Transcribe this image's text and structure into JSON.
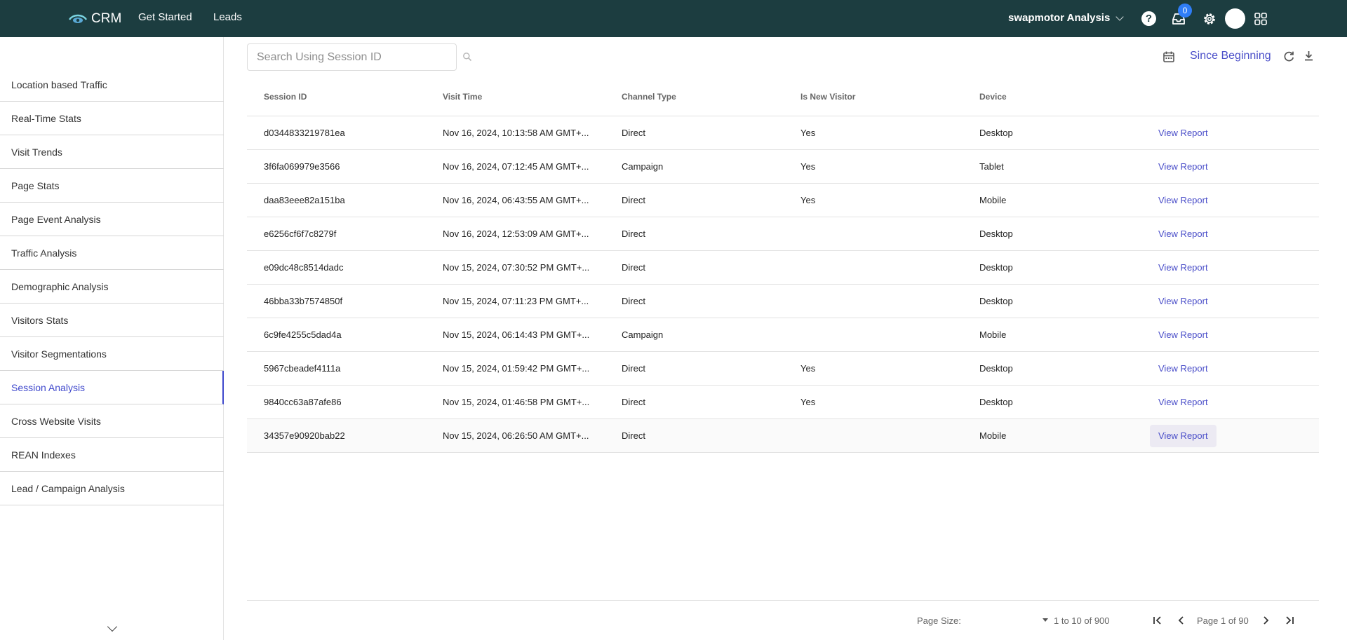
{
  "topbar": {
    "app_name": "CRM",
    "nav": [
      "Get Started",
      "Leads"
    ],
    "workspace": "swapmotor Analysis",
    "notification_count": "0",
    "background_color": "#1c3d40"
  },
  "sidebar": {
    "items": [
      {
        "label": "Location based Traffic"
      },
      {
        "label": "Real-Time Stats"
      },
      {
        "label": "Visit Trends"
      },
      {
        "label": "Page Stats"
      },
      {
        "label": "Page Event Analysis"
      },
      {
        "label": "Traffic Analysis"
      },
      {
        "label": "Demographic Analysis"
      },
      {
        "label": "Visitors Stats"
      },
      {
        "label": "Visitor Segmentations"
      },
      {
        "label": "Session Analysis"
      },
      {
        "label": "Cross Website Visits"
      },
      {
        "label": "REAN Indexes"
      },
      {
        "label": "Lead / Campaign Analysis"
      }
    ],
    "active_index": 9,
    "accent_color": "#3f48cc"
  },
  "toolbar": {
    "search_placeholder": "Search Using Session ID",
    "date_range": "Since Beginning"
  },
  "table": {
    "headers": [
      "Session ID",
      "Visit Time",
      "Channel Type",
      "Is New Visitor",
      "Device"
    ],
    "action_label": "View Report",
    "rows": [
      {
        "session_id": "d0344833219781ea",
        "visit_time": "Nov 16, 2024, 10:13:58 AM GMT+...",
        "channel": "Direct",
        "new_visitor": "Yes",
        "device": "Desktop"
      },
      {
        "session_id": "3f6fa069979e3566",
        "visit_time": "Nov 16, 2024, 07:12:45 AM GMT+...",
        "channel": "Campaign",
        "new_visitor": "Yes",
        "device": "Tablet"
      },
      {
        "session_id": "daa83eee82a151ba",
        "visit_time": "Nov 16, 2024, 06:43:55 AM GMT+...",
        "channel": "Direct",
        "new_visitor": "Yes",
        "device": "Mobile"
      },
      {
        "session_id": "e6256cf6f7c8279f",
        "visit_time": "Nov 16, 2024, 12:53:09 AM GMT+...",
        "channel": "Direct",
        "new_visitor": "",
        "device": "Desktop"
      },
      {
        "session_id": "e09dc48c8514dadc",
        "visit_time": "Nov 15, 2024, 07:30:52 PM GMT+...",
        "channel": "Direct",
        "new_visitor": "",
        "device": "Desktop"
      },
      {
        "session_id": "46bba33b7574850f",
        "visit_time": "Nov 15, 2024, 07:11:23 PM GMT+...",
        "channel": "Direct",
        "new_visitor": "",
        "device": "Desktop"
      },
      {
        "session_id": "6c9fe4255c5dad4a",
        "visit_time": "Nov 15, 2024, 06:14:43 PM GMT+...",
        "channel": "Campaign",
        "new_visitor": "",
        "device": "Mobile"
      },
      {
        "session_id": "5967cbeadef4111a",
        "visit_time": "Nov 15, 2024, 01:59:42 PM GMT+...",
        "channel": "Direct",
        "new_visitor": "Yes",
        "device": "Desktop"
      },
      {
        "session_id": "9840cc63a87afe86",
        "visit_time": "Nov 15, 2024, 01:46:58 PM GMT+...",
        "channel": "Direct",
        "new_visitor": "Yes",
        "device": "Desktop"
      },
      {
        "session_id": "34357e90920bab22",
        "visit_time": "Nov 15, 2024, 06:26:50 AM GMT+...",
        "channel": "Direct",
        "new_visitor": "",
        "device": "Mobile"
      }
    ],
    "hovered_row_index": 9,
    "link_color": "#4b4fc9"
  },
  "pagination": {
    "page_size_label": "Page Size:",
    "range": "1 to 10 of 900",
    "page_info": "Page 1 of 90"
  }
}
